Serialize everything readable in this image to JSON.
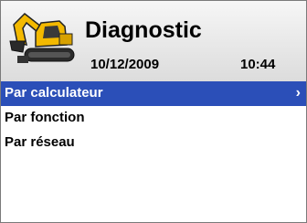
{
  "header": {
    "title": "Diagnostic",
    "date": "10/12/2009",
    "time": "10:44",
    "icon": "excavator-icon"
  },
  "menu": {
    "items": [
      {
        "label": "Par calculateur",
        "selected": true,
        "chevron": "›"
      },
      {
        "label": "Par fonction",
        "selected": false
      },
      {
        "label": "Par réseau",
        "selected": false
      }
    ]
  },
  "colors": {
    "selection": "#2b4fb8",
    "header_bg": "#e6e6e6",
    "machine_yellow": "#f3b900"
  }
}
